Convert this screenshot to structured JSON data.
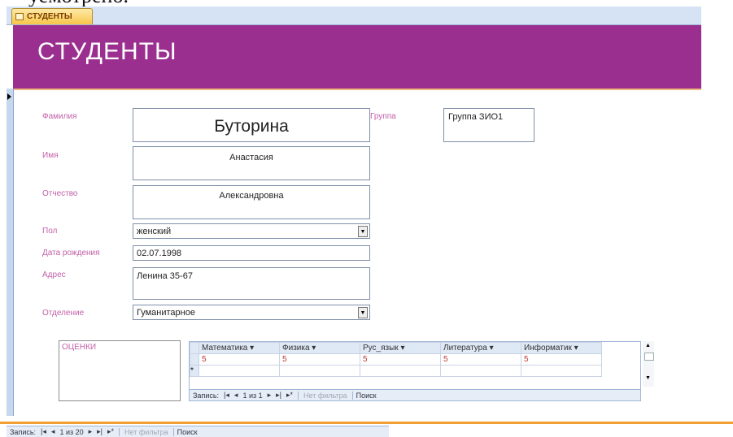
{
  "doc_text": "уемотрено.",
  "tab": {
    "label": "СТУДЕНТЫ"
  },
  "header": {
    "title": "СТУДЕНТЫ"
  },
  "fields": {
    "surname": {
      "label": "Фамилия",
      "value": "Буторина"
    },
    "group": {
      "label": "Группа",
      "value": "Группа ЗИО1"
    },
    "name": {
      "label": "Имя",
      "value": "Анастасия"
    },
    "patronymic": {
      "label": "Отчество",
      "value": "Александровна"
    },
    "gender": {
      "label": "Пол",
      "value": "женский"
    },
    "birthdate": {
      "label": "Дата рождения",
      "value": "02.07.1998"
    },
    "address": {
      "label": "Адрес",
      "value": "Ленина 35-67"
    },
    "department": {
      "label": "Отделение",
      "value": "Гуманитарное"
    }
  },
  "grades": {
    "label": "ОЦЕНКИ",
    "columns": [
      "Математика",
      "Физика",
      "Рус_язык",
      "Литература",
      "Информатик"
    ],
    "row": [
      "5",
      "5",
      "5",
      "5",
      "5"
    ],
    "new_row_marker": "*"
  },
  "subnav": {
    "records_label": "Запись:",
    "position": "1 из 1",
    "filter_label": "Нет фильтра",
    "search_label": "Поиск"
  },
  "mainnav": {
    "records_label": "Запись:",
    "position": "1 из 20",
    "filter_label": "Нет фильтра",
    "search_label": "Поиск"
  }
}
